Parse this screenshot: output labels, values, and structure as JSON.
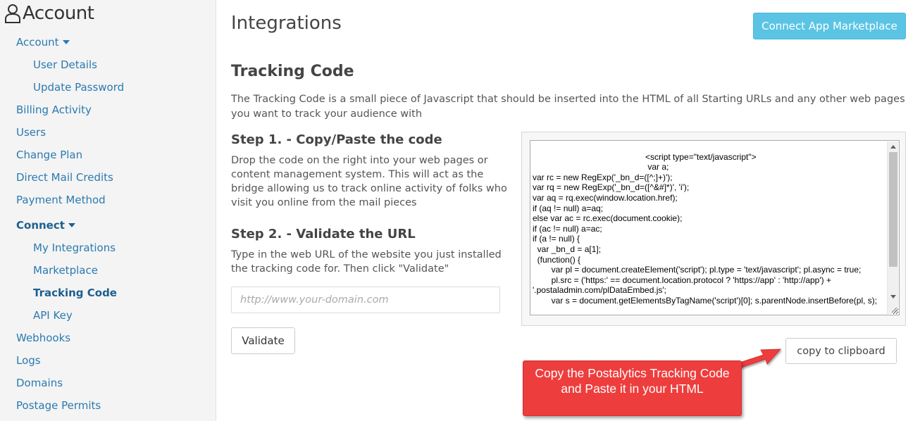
{
  "sidebar": {
    "title": "Account",
    "items": [
      {
        "label": "Account",
        "level": 1,
        "caret": true,
        "bold": false
      },
      {
        "label": "User Details",
        "level": 2,
        "caret": false,
        "bold": false
      },
      {
        "label": "Update Password",
        "level": 2,
        "caret": false,
        "bold": false
      },
      {
        "label": "Billing Activity",
        "level": 1,
        "caret": false,
        "bold": false
      },
      {
        "label": "Users",
        "level": 1,
        "caret": false,
        "bold": false
      },
      {
        "label": "Change Plan",
        "level": 1,
        "caret": false,
        "bold": false
      },
      {
        "label": "Direct Mail Credits",
        "level": 1,
        "caret": false,
        "bold": false
      },
      {
        "label": "Payment Method",
        "level": 1,
        "caret": false,
        "bold": false
      },
      {
        "label": "Connect",
        "level": 1,
        "caret": true,
        "bold": true
      },
      {
        "label": "My Integrations",
        "level": 2,
        "caret": false,
        "bold": false
      },
      {
        "label": "Marketplace",
        "level": 2,
        "caret": false,
        "bold": false
      },
      {
        "label": "Tracking Code",
        "level": 2,
        "caret": false,
        "bold": true
      },
      {
        "label": "API Key",
        "level": 2,
        "caret": false,
        "bold": false
      },
      {
        "label": "Webhooks",
        "level": 1,
        "caret": false,
        "bold": false
      },
      {
        "label": "Logs",
        "level": 1,
        "caret": false,
        "bold": false
      },
      {
        "label": "Domains",
        "level": 1,
        "caret": false,
        "bold": false
      },
      {
        "label": "Postage Permits",
        "level": 1,
        "caret": false,
        "bold": false
      }
    ]
  },
  "main": {
    "title": "Integrations",
    "marketplace_button": "Connect App Marketplace",
    "section_title": "Tracking Code",
    "intro": "The Tracking Code is a small piece of Javascript that should be inserted into the HTML of all Starting URLs and any other web pages you want to track your audience with",
    "step1": {
      "title": "Step 1. - Copy/Paste the code",
      "desc": "Drop the code on the right into your web pages or content management system. This will act as the bridge allowing us to track online activity of folks who visit you online from the mail pieces"
    },
    "step2": {
      "title": "Step 2. - Validate the URL",
      "desc": "Type in the web URL of the website you just installed the tracking code for. Then click \"Validate\""
    },
    "url_input": {
      "value": "",
      "placeholder": "http://www.your-domain.com"
    },
    "validate_button": "Validate",
    "code": "\t\t\t\t\t\t<script type=\"text/javascript\">\n\t\t\t\t\t\t var a;\nvar rc = new RegExp('_bn_d=([^;]+)');\nvar rq = new RegExp('_bn_d=([^&#]*)', 'i');\nvar aq = rq.exec(window.location.href);\nif (aq != null) a=aq;\nelse var ac = rc.exec(document.cookie);\nif (ac != null) a=ac;\nif (a != null) {\n  var _bn_d = a[1];\n  (function() {\n        var pl = document.createElement('script'); pl.type = 'text/javascript'; pl.async = true;\n        pl.src = ('https:' == document.location.protocol ? 'https://app' : 'http://app') + '.postaladmin.com/plDataEmbed.js';\n        var s = document.getElementsByTagName('script')[0]; s.parentNode.insertBefore(pl, s);",
    "copy_button": "copy to clipboard",
    "callout": "Copy the Postalytics Tracking Code and Paste it in your HTML"
  },
  "colors": {
    "link": "#2a7ab0",
    "marketplace_button": "#5bc4e4",
    "callout": "#ee3d3d"
  }
}
